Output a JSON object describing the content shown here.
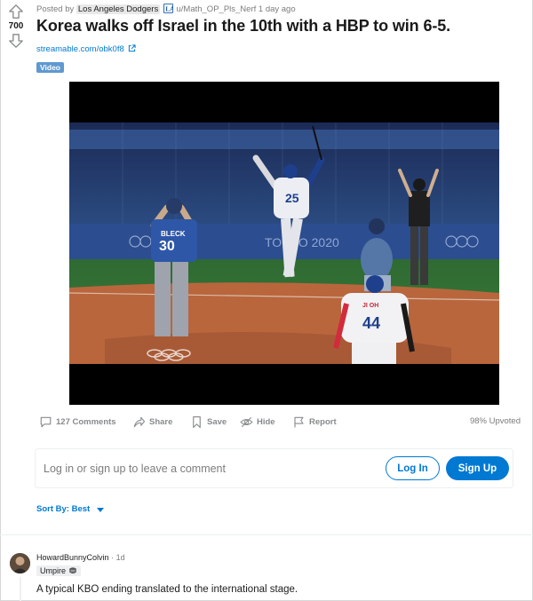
{
  "post": {
    "score": "700",
    "posted_by_prefix": "Posted by",
    "subreddit_flair": "Los Angeles Dodgers",
    "author": "u/Math_OP_Pls_Nerf",
    "age": "1 day ago",
    "title": "Korea walks off Israel in the 10th with a HBP to win 6-5.",
    "link_text": "streamable.com/obk0f8",
    "tag": "Video"
  },
  "video": {
    "scoreboard_text": "TOKYO 2020",
    "players": [
      {
        "name": "ISRAEL PITCHER",
        "jersey_name": "BLECK",
        "number": "30"
      },
      {
        "name": "KOREA BATTER",
        "number": "25"
      },
      {
        "name": "KOREA RUNNER",
        "jersey_name": "JI OH",
        "number": "44"
      }
    ]
  },
  "actions": {
    "comments": "127 Comments",
    "share": "Share",
    "save": "Save",
    "hide": "Hide",
    "report": "Report",
    "upvoted": "98% Upvoted"
  },
  "login": {
    "prompt": "Log in or sign up to leave a comment",
    "login_button": "Log In",
    "signup_button": "Sign Up"
  },
  "sort": {
    "label": "Sort By: Best"
  },
  "comment": {
    "author": "HowardBunnyColvin",
    "separator": "·",
    "age": "1d",
    "flair": "Umpire",
    "body": "A typical KBO ending translated to the international stage."
  },
  "colors": {
    "accent": "#0079d3",
    "tag": "#5f99cf"
  }
}
